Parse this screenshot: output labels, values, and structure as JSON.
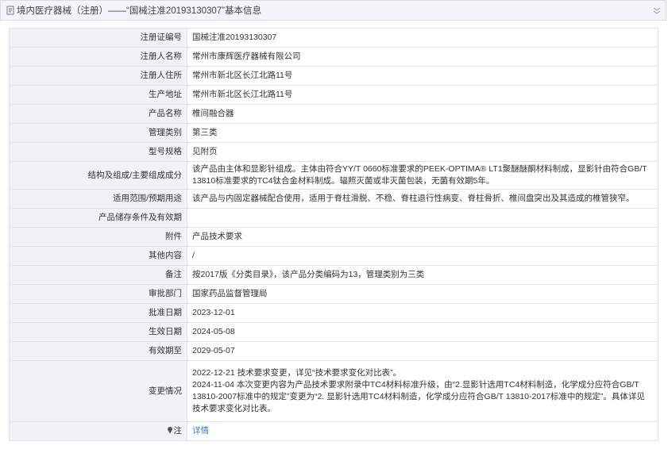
{
  "header": {
    "title": "境内医疗器械（注册）——“国械注准20193130307”基本信息",
    "doc_icon": "document-icon",
    "toggle_icon": "collapse-icon"
  },
  "rows": [
    {
      "label": "注册证编号",
      "value": "国械注准20193130307"
    },
    {
      "label": "注册人名称",
      "value": "常州市康辉医疗器械有限公司"
    },
    {
      "label": "注册人住所",
      "value": "常州市新北区长江北路11号"
    },
    {
      "label": "生产地址",
      "value": "常州市新北区长江北路11号"
    },
    {
      "label": "产品名称",
      "value": "椎间融合器"
    },
    {
      "label": "管理类别",
      "value": "第三类"
    },
    {
      "label": "型号规格",
      "value": "见附页"
    },
    {
      "label": "结构及组成/主要组成成分",
      "value": "该产品由主体和显影针组成。主体由符合YY/T 0660标准要求的PEEK-OPTIMA® LT1聚醚醚酮材料制成，显影针由符合GB/T 13810标准要求的TC4钛合金材料制成。辐照灭菌或非灭菌包装，无菌有效期5年。"
    },
    {
      "label": "适用范围/预期用途",
      "value": "该产品与内固定器械配合使用，适用于脊柱滑脱、不稳、脊柱退行性病变、脊柱骨折、椎间盘突出及其造成的椎管狭窄。"
    },
    {
      "label": "产品储存条件及有效期",
      "value": ""
    },
    {
      "label": "附件",
      "value": "产品技术要求"
    },
    {
      "label": "其他内容",
      "value": "/"
    },
    {
      "label": "备注",
      "value": "按2017版《分类目录》，该产品分类编码为13，管理类别为三类"
    },
    {
      "label": "审批部门",
      "value": "国家药品监督管理局"
    },
    {
      "label": "批准日期",
      "value": "2023-12-01"
    },
    {
      "label": "生效日期",
      "value": "2024-05-08"
    },
    {
      "label": "有效期至",
      "value": "2029-05-07"
    },
    {
      "label": "变更情况",
      "value": "2022-12-21 技术要求变更，详见“技术要求变化对比表”。\n2024-11-04 本次变更内容为产品技术要求附录中TC4材料标准升级，由“2.显影针选用TC4材料制造，化学成分应符合GB/T 13810-2007标准中的规定”变更为“2. 显影针选用TC4材料制造，化学成分应符合GB/T 13810-2017标准中的规定”。具体详见技术要求变化对比表。"
    }
  ],
  "note": {
    "label": "注",
    "pin_icon": "pin-icon",
    "link_text": "详情"
  }
}
